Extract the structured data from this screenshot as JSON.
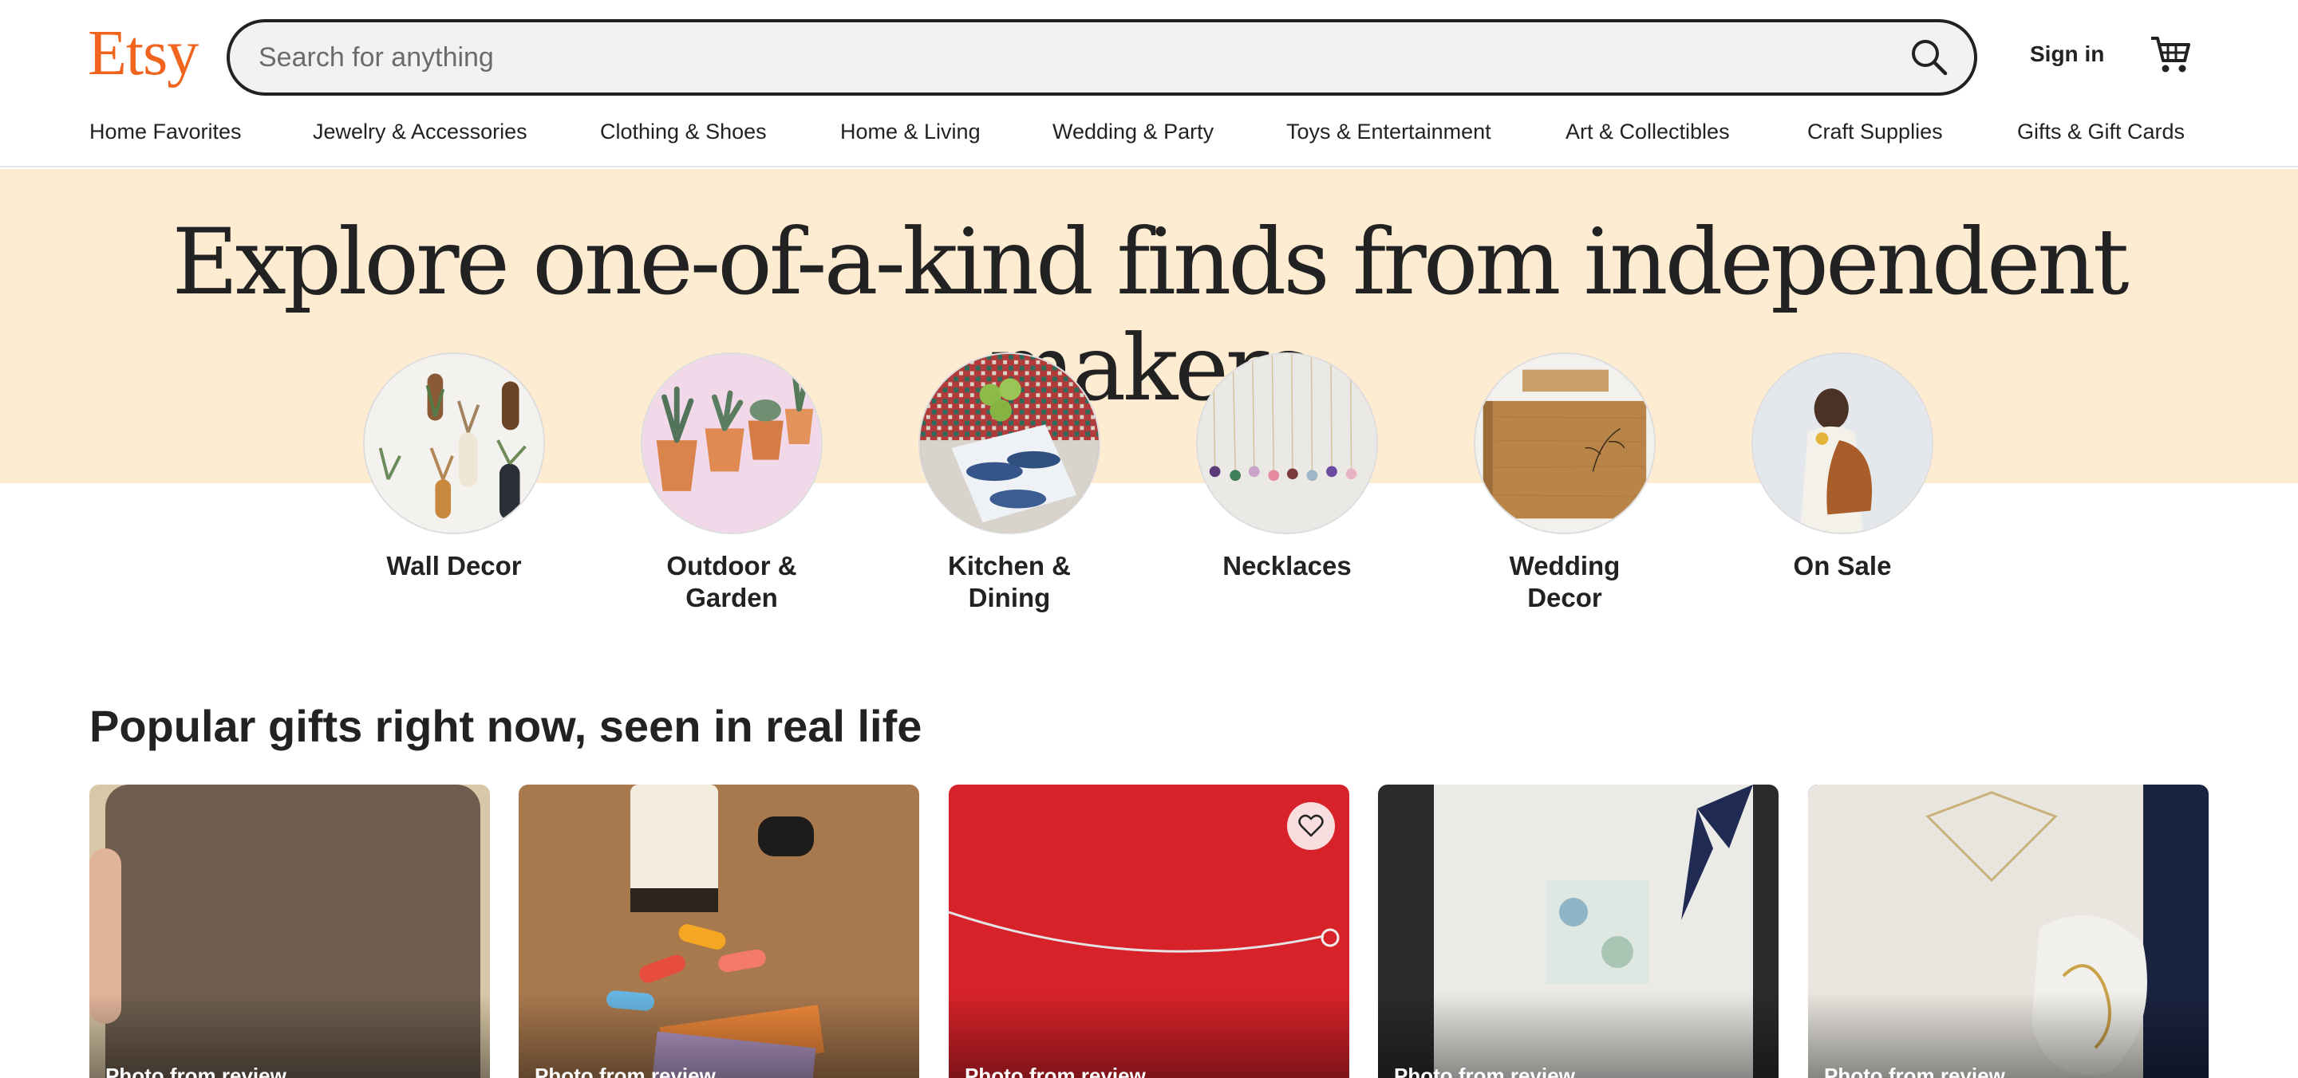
{
  "header": {
    "logo": "Etsy",
    "search_placeholder": "Search for anything",
    "search_icon": "search-icon",
    "signin_label": "Sign in",
    "cart_icon": "cart-icon"
  },
  "nav": {
    "items": [
      "Home Favorites",
      "Jewelry & Accessories",
      "Clothing & Shoes",
      "Home & Living",
      "Wedding & Party",
      "Toys & Entertainment",
      "Art & Collectibles",
      "Craft Supplies",
      "Gifts & Gift Cards"
    ]
  },
  "hero": {
    "title": "Explore one-of-a-kind finds from independent makers",
    "categories": [
      {
        "label": "Wall Decor"
      },
      {
        "label": "Outdoor & Garden"
      },
      {
        "label": "Kitchen & Dining"
      },
      {
        "label": "Necklaces"
      },
      {
        "label": "Wedding Decor"
      },
      {
        "label": "On Sale"
      }
    ]
  },
  "popular": {
    "title": "Popular gifts right now, seen in real life",
    "cards": [
      {
        "caption": "Photo from review"
      },
      {
        "caption": "Photo from review"
      },
      {
        "caption": "Photo from review",
        "favorite_icon": "heart-icon"
      },
      {
        "caption": "Photo from review"
      },
      {
        "caption": "Photo from review"
      }
    ]
  },
  "colors": {
    "brand": "#F1641E",
    "hero_bg": "#FDEBD2",
    "text": "#222222"
  }
}
